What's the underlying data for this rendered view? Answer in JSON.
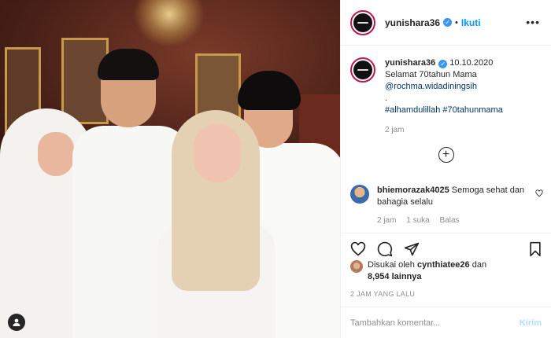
{
  "post": {
    "username": "yunishara36",
    "follow_label": "Ikuti",
    "more_label": "•••"
  },
  "caption": {
    "username": "yunishara36",
    "date": "10.10.2020",
    "line1": "Selamat 70tahun Mama",
    "mention": "@rochma.widadiningsih",
    "separator": ".",
    "hashtags": "#alhamdulillah #70tahunmama",
    "time": "2 jam"
  },
  "comment": {
    "username": "bhiemorazak4025",
    "text": "Semoga sehat dan bahagia selalu",
    "time": "2 jam",
    "likes": "1 suka",
    "reply": "Balas"
  },
  "likes": {
    "prefix": "Disukai oleh",
    "user": "cynthiatee26",
    "conj": "dan",
    "count": "8,954 lainnya"
  },
  "posted_time": "2 JAM YANG LALU",
  "add_comment": {
    "placeholder": "Tambahkan komentar...",
    "post_label": "Kirim"
  },
  "colors": {
    "accent": "#0095f6",
    "verified": "#3897f0",
    "link": "#003569",
    "muted": "#8e8e8e"
  }
}
